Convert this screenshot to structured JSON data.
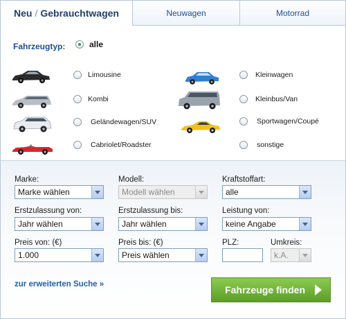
{
  "tabs": [
    {
      "label_a": "Neu",
      "sep": "/",
      "label_b": "Gebrauchtwagen"
    },
    {
      "label": "Neuwagen"
    },
    {
      "label": "Motorrad"
    }
  ],
  "fahrzeugtyp": {
    "label": "Fahrzeugtyp:",
    "all_option": "alle",
    "vehicles": [
      {
        "label": "Limousine",
        "icon": "sedan-car-icon",
        "color": "#2b2b2b"
      },
      {
        "label": "Kleinwagen",
        "icon": "small-car-icon",
        "color": "#2f7fd4"
      },
      {
        "label": "Kombi",
        "icon": "station-wagon-icon",
        "color": "#b9bec6"
      },
      {
        "label": "Kleinbus/Van",
        "icon": "van-icon",
        "color": "#9aa3ad"
      },
      {
        "label": "Geländewagen/SUV",
        "icon": "suv-icon",
        "color": "#e8ebef"
      },
      {
        "label": "Sportwagen/Coupé",
        "icon": "sports-car-icon",
        "color": "#f2c21b"
      },
      {
        "label": "Cabriolet/Roadster",
        "icon": "convertible-icon",
        "color": "#d8262b"
      },
      {
        "label": "sonstige"
      }
    ]
  },
  "filters": {
    "marke": {
      "label": "Marke:",
      "value": "Marke wählen"
    },
    "modell": {
      "label": "Modell:",
      "value": "Modell wählen"
    },
    "kraftstoff": {
      "label": "Kraftstoffart:",
      "value": "alle"
    },
    "ez_von": {
      "label": "Erstzulassung von:",
      "value": "Jahr wählen"
    },
    "ez_bis": {
      "label": "Erstzulassung bis:",
      "value": "Jahr wählen"
    },
    "leistung": {
      "label": "Leistung von:",
      "value": "keine Angabe"
    },
    "preis_von": {
      "label": "Preis von: (€)",
      "value": "1.000"
    },
    "preis_bis": {
      "label": "Preis bis: (€)",
      "value": "Preis wählen"
    },
    "plz": {
      "label": "PLZ:",
      "value": ""
    },
    "umkreis": {
      "label": "Umkreis:",
      "value": "k.A."
    }
  },
  "extended_search": "zur erweiterten Suche »",
  "find_button": "Fahrzeuge finden",
  "colors": {
    "accent": "#1f4e8c",
    "button": "#6fb13a",
    "link": "#1f5fa8"
  }
}
